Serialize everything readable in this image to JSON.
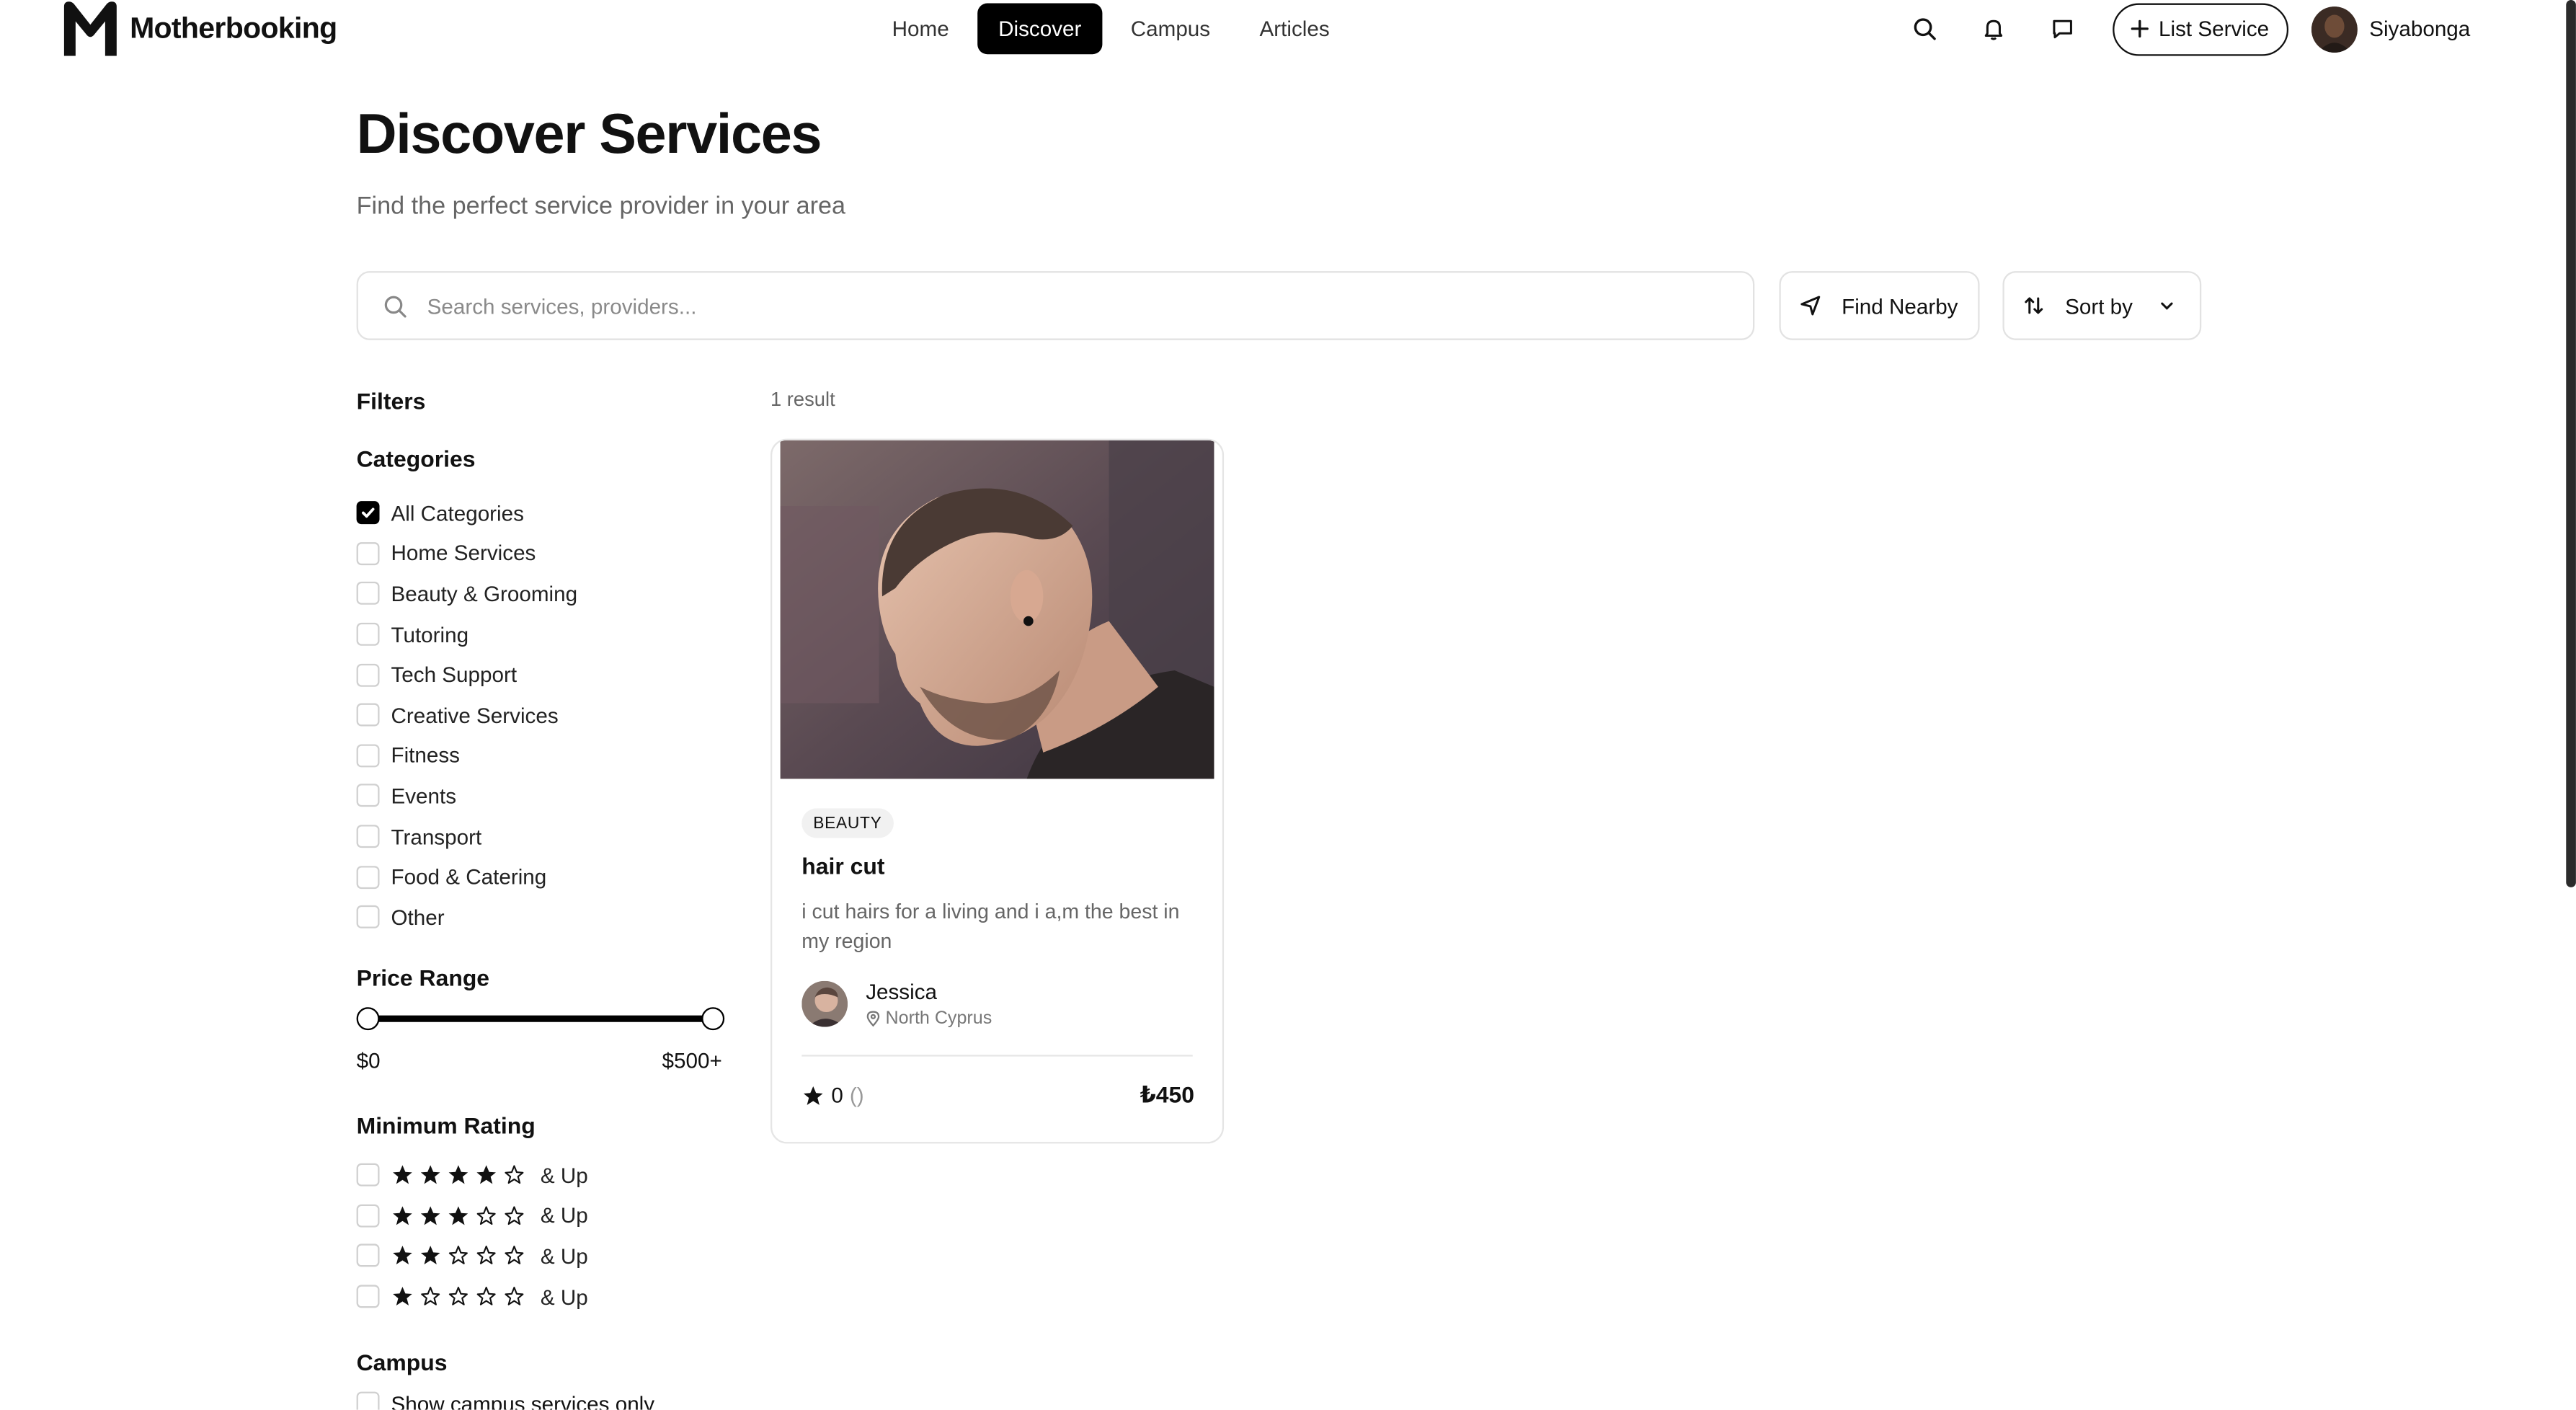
{
  "brand": {
    "name": "Motherbooking"
  },
  "nav": {
    "items": [
      {
        "label": "Home",
        "active": false
      },
      {
        "label": "Discover",
        "active": true
      },
      {
        "label": "Campus",
        "active": false
      },
      {
        "label": "Articles",
        "active": false
      }
    ]
  },
  "topbar": {
    "icons": [
      "search-icon",
      "bell-icon",
      "message-icon"
    ],
    "list_service_label": "List Service",
    "user_name": "Siyabonga"
  },
  "header": {
    "title": "Discover Services",
    "subtitle": "Find the perfect service provider in your area"
  },
  "search": {
    "placeholder": "Search services, providers...",
    "value": ""
  },
  "toolbar": {
    "find_nearby_label": "Find Nearby",
    "sort_by_label": "Sort by"
  },
  "filters": {
    "title": "Filters",
    "categories_title": "Categories",
    "categories": [
      {
        "label": "All Categories",
        "checked": true
      },
      {
        "label": "Home Services",
        "checked": false
      },
      {
        "label": "Beauty & Grooming",
        "checked": false
      },
      {
        "label": "Tutoring",
        "checked": false
      },
      {
        "label": "Tech Support",
        "checked": false
      },
      {
        "label": "Creative Services",
        "checked": false
      },
      {
        "label": "Fitness",
        "checked": false
      },
      {
        "label": "Events",
        "checked": false
      },
      {
        "label": "Transport",
        "checked": false
      },
      {
        "label": "Food & Catering",
        "checked": false
      },
      {
        "label": "Other",
        "checked": false
      }
    ],
    "price_title": "Price Range",
    "price_min_label": "$0",
    "price_max_label": "$500+",
    "price_range_fraction": [
      0,
      1
    ],
    "rating_title": "Minimum Rating",
    "ratings": [
      {
        "stars": 4,
        "label": "& Up",
        "checked": false
      },
      {
        "stars": 3,
        "label": "& Up",
        "checked": false
      },
      {
        "stars": 2,
        "label": "& Up",
        "checked": false
      },
      {
        "stars": 1,
        "label": "& Up",
        "checked": false
      }
    ],
    "campus_title": "Campus",
    "campus_option_label": "Show campus services only"
  },
  "results": {
    "count_label": "1 result",
    "cards": [
      {
        "badge": "BEAUTY",
        "title": "hair cut",
        "description": "i cut hairs for a living and i a,m the best in my region",
        "provider_name": "Jessica",
        "provider_location": "North Cyprus",
        "rating": "0",
        "rating_count": "()",
        "price": "₺450"
      }
    ]
  },
  "colors": {
    "accent": "#000000",
    "muted_text": "#666666",
    "border": "#e2e2e2"
  }
}
